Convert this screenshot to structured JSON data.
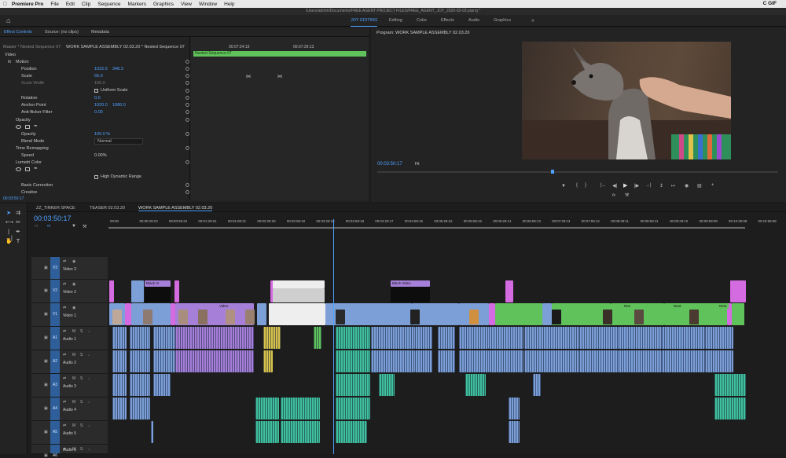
{
  "menubar": {
    "app": "Premiere Pro",
    "items": [
      "File",
      "Edit",
      "Clip",
      "Sequence",
      "Markers",
      "Graphics",
      "View",
      "Window",
      "Help"
    ],
    "status_right": "C GIF"
  },
  "title_path": "/Users/admin/Documents/FREE AGENT PROJECT FILES/FREE_AGENT_JOY_2020-02-03.prproj *",
  "workspaces": [
    "JOY EDITING",
    "Editing",
    "Color",
    "Effects",
    "Audio",
    "Graphics"
  ],
  "effect_controls": {
    "tabs": [
      "Effect Controls",
      "Source: (no clips)",
      "Metadata"
    ],
    "source_label": "Master * Nested Sequence 07",
    "sequence_label": "WORK SAMPLE ASSEMBLY 02.03.20 * Nested Sequence 07",
    "section_video": "Video",
    "motion": "Motion",
    "position_label": "Position",
    "position_x": "1022.6",
    "position_y": "348.3",
    "scale_label": "Scale",
    "scale_val": "66.0",
    "scale_width_label": "Scale Width",
    "scale_width_val": "100.0",
    "uniform_scale": "Uniform Scale",
    "rotation_label": "Rotation",
    "rotation_val": "0.0",
    "anchor_label": "Anchor Point",
    "anchor_x": "1920.0",
    "anchor_y": "1080.0",
    "antiflicker_label": "Anti-flicker Filter",
    "antiflicker_val": "0.00",
    "opacity_section": "Opacity",
    "opacity_label": "Opacity",
    "opacity_val": "100.0 %",
    "blend_label": "Blend Mode",
    "blend_val": "Normal",
    "time_remap": "Time Remapping",
    "speed_label": "Speed",
    "speed_val": "0.00%",
    "lumetri": "Lumetri Color",
    "hdr": "High Dynamic Range",
    "basic_correction": "Basic Correction",
    "creative": "Creative",
    "timecode": "00:03:50:17",
    "mini_tl_time1": "00:07:24:13",
    "mini_tl_time2": "00:07:29:13",
    "nested_clip": "Nested Sequence 07"
  },
  "program": {
    "title": "Program: WORK SAMPLE ASSEMBLY 02.03.20",
    "timecode": "00:03:50:17",
    "fit": "Fit"
  },
  "timeline": {
    "tabs": [
      "ZZ_TINKER SPACE",
      "TEASER 02.03.20",
      "WORK SAMPLE ASSEMBLY 02.03.20"
    ],
    "timecode": "00:03:50:17",
    "ruler": [
      "00:00",
      "00:00:29:23",
      "00:00:59:22",
      "00:01:29:21",
      "00:01:59:21",
      "00:02:29:20",
      "00:02:59:19",
      "00:03:29:18",
      "00:03:59:18",
      "00:04:29:17",
      "00:04:59:16",
      "00:05:29:16",
      "00:05:59:15",
      "00:06:29:14",
      "00:06:59:13",
      "00:07:29:13",
      "00:07:59:12",
      "00:08:29:11",
      "00:08:59:11",
      "00:09:29:10",
      "00:09:59:09",
      "00:10:29:08",
      "00:10:59:08"
    ],
    "tracks": [
      {
        "id": "V3",
        "name": "Video 3"
      },
      {
        "id": "V2",
        "name": "Video 2"
      },
      {
        "id": "V1",
        "name": "Video 1"
      },
      {
        "id": "A1",
        "name": "Audio 1"
      },
      {
        "id": "A2",
        "name": "Audio 2"
      },
      {
        "id": "A3",
        "name": "Audio 3"
      },
      {
        "id": "A4",
        "name": "Audio 4"
      },
      {
        "id": "A5",
        "name": "Audio 5"
      },
      {
        "id": "A6",
        "name": "Audio 6"
      }
    ],
    "clip_labels": {
      "black_video_1": "Black Vi",
      "black_video_2": "Black Video",
      "video": "Video",
      "nest_1": "Nes",
      "nest_2": "Nest",
      "nest_3": "Nest"
    }
  },
  "colors": {
    "accent": "#4ea1ff",
    "clip_blue": "#7b9fd6",
    "clip_green": "#5fc25a",
    "clip_pink": "#d56be0",
    "clip_purple": "#a57fd8",
    "audio_teal": "#3fbf9a",
    "audio_yellow": "#d6c24a",
    "dark": "#1b1b1b"
  }
}
